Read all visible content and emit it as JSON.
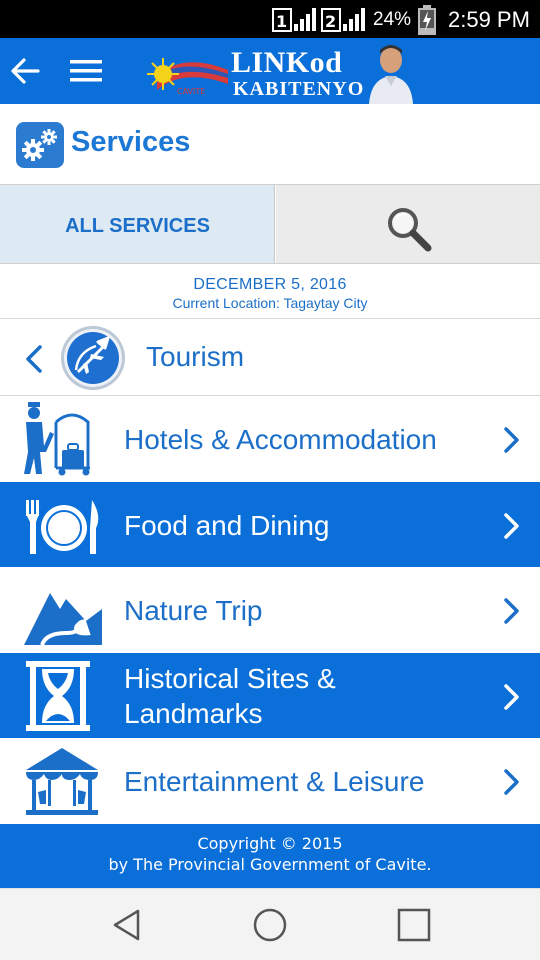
{
  "status_bar": {
    "sim1": "1",
    "sim2": "2",
    "battery": "24%",
    "time": "2:59 PM"
  },
  "app_bar": {
    "brand_title": "LINKod",
    "brand_subtitle": "KABITENYO",
    "brand_small": "CAVITE"
  },
  "header": {
    "title": "Services"
  },
  "tabs": {
    "all_services": "ALL SERVICES"
  },
  "info": {
    "date": "DECEMBER 5, 2016",
    "location": "Current Location: Tagaytay City"
  },
  "category": {
    "label": "Tourism"
  },
  "items": [
    {
      "label": "Hotels & Accommodation",
      "icon": "bellhop-icon",
      "style": "white"
    },
    {
      "label": "Food and Dining",
      "icon": "plate-cutlery-icon",
      "style": "blue"
    },
    {
      "label": "Nature Trip",
      "icon": "mountain-icon",
      "style": "white"
    },
    {
      "label_line1": "Historical Sites &",
      "label_line2": "Landmarks",
      "icon": "hourglass-icon",
      "style": "blue"
    },
    {
      "label": "Entertainment & Leisure",
      "icon": "carousel-icon",
      "style": "white"
    }
  ],
  "footer": {
    "line1": "Copyright © 2015",
    "line2": "by The Provincial Government of Cavite."
  },
  "colors": {
    "primary": "#0a6fd8",
    "text_blue": "#1c6fc8",
    "tab_active_bg": "#dde9f3"
  }
}
